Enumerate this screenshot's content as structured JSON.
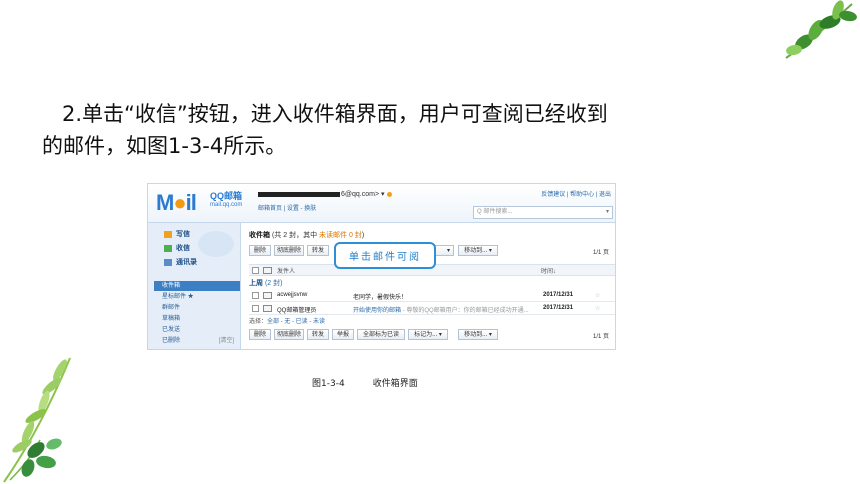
{
  "body_text": {
    "line1": "2.单击“收信”按钮，进入收件箱界面，用户可查阅已经收到",
    "line2": "的邮件，如图1-3-4所示。"
  },
  "caption": {
    "number": "图1-3-4",
    "title": "收件箱界面"
  },
  "callout": {
    "text": "单击邮件可阅"
  },
  "screenshot": {
    "logo": {
      "word": "MAIL",
      "brand": "QQ邮箱",
      "domain": "mail.qq.com"
    },
    "account": {
      "email_suffix": "6@qq.com>",
      "links": "邮箱首页 | 设置 - 换肤"
    },
    "top_links": "反馈建议 | 帮助中心 | 退出",
    "search_placeholder": "Q 邮件搜索...",
    "sidebar": {
      "actions": [
        {
          "label": "写信",
          "icon": "pencil-icon"
        },
        {
          "label": "收信",
          "icon": "inbox-icon"
        },
        {
          "label": "通讯录",
          "icon": "contacts-icon"
        }
      ],
      "folders": [
        "收件箱",
        "星标邮件 ★",
        "群邮件",
        "草稿箱",
        "已发送",
        "已删除"
      ],
      "clear_label": "[清空]"
    },
    "inbox": {
      "title": "收件箱",
      "summary": "(共 2 封，其中",
      "unread": "未读邮件 0 封",
      "summary_end": ")",
      "toolbar": [
        "删除",
        "彻底删除",
        "转发",
        "举报",
        "全部标为已读",
        "标记为... ▾",
        "移动到... ▾"
      ],
      "pager": "1/1 页",
      "columns": {
        "sender": "发件人",
        "time": "时间↓"
      },
      "group_label": "上周",
      "group_count": "(2 封)",
      "rows": [
        {
          "sender": "acwejjsvnw",
          "subject": "老同学，暑假快乐！",
          "preview": "",
          "date": "2017/12/31"
        },
        {
          "sender": "QQ邮箱管理员",
          "subject": "开始使用你的邮箱",
          "preview": " - 尊敬的QQ邮箱用户：你的邮箱已经成功开通...",
          "date": "2017/12/31"
        }
      ],
      "select_label": "选择：",
      "select_options": "全部 - 无 - 已读 - 未读"
    }
  }
}
